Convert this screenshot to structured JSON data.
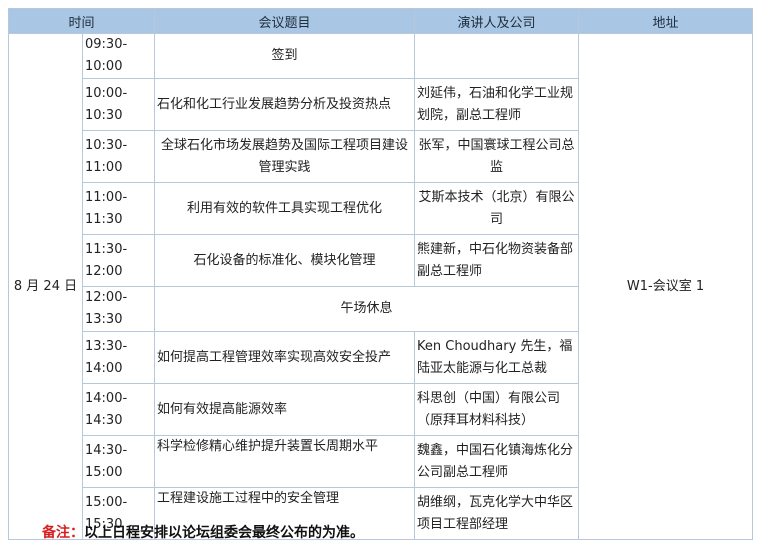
{
  "headers": {
    "time": "时间",
    "topic": "会议题目",
    "speaker": "演讲人及公司",
    "address": "地址"
  },
  "date": "8 月 24 日",
  "address": "W1-会议室 1",
  "rows": [
    {
      "time": "09:30-10:00",
      "topic": "签到",
      "speaker": ""
    },
    {
      "time": "10:00-10:30",
      "topic": "石化和化工行业发展趋势分析及投资热点",
      "speaker": "刘延伟，石油和化学工业规划院，副总工程师"
    },
    {
      "time": "10:30-11:00",
      "topic": "全球石化市场发展趋势及国际工程项目建设管理实践",
      "speaker": "张军，中国寰球工程公司总监"
    },
    {
      "time": "11:00-11:30",
      "topic": "利用有效的软件工具实现工程优化",
      "speaker": "艾斯本技术（北京）有限公司"
    },
    {
      "time": "11:30-12:00",
      "topic": "石化设备的标准化、模块化管理",
      "speaker": "熊建新，中石化物资装备部副总工程师"
    },
    {
      "time": "12:00-13:30",
      "topic": "午场休息",
      "speaker": ""
    },
    {
      "time": "13:30-14:00",
      "topic": "如何提高工程管理效率实现高效安全投产",
      "speaker": "Ken Choudhary 先生，福陆亚太能源与化工总裁"
    },
    {
      "time": "14:00-14:30",
      "topic": "如何有效提高能源效率",
      "speaker": "科思创（中国）有限公司（原拜耳材料科技）"
    },
    {
      "time": "14:30-15:00",
      "topic": "科学检修精心维护提升装置长周期水平",
      "speaker": "魏鑫，中国石化镇海炼化分公司副总工程师"
    },
    {
      "time": "15:00-15:30",
      "topic": "工程建设施工过程中的安全管理",
      "speaker": "胡维纲，瓦克化学大中华区项目工程部经理"
    }
  ],
  "note": {
    "label": "备注：",
    "text": "以上日程安排以论坛组委会最终公布的为准。"
  }
}
